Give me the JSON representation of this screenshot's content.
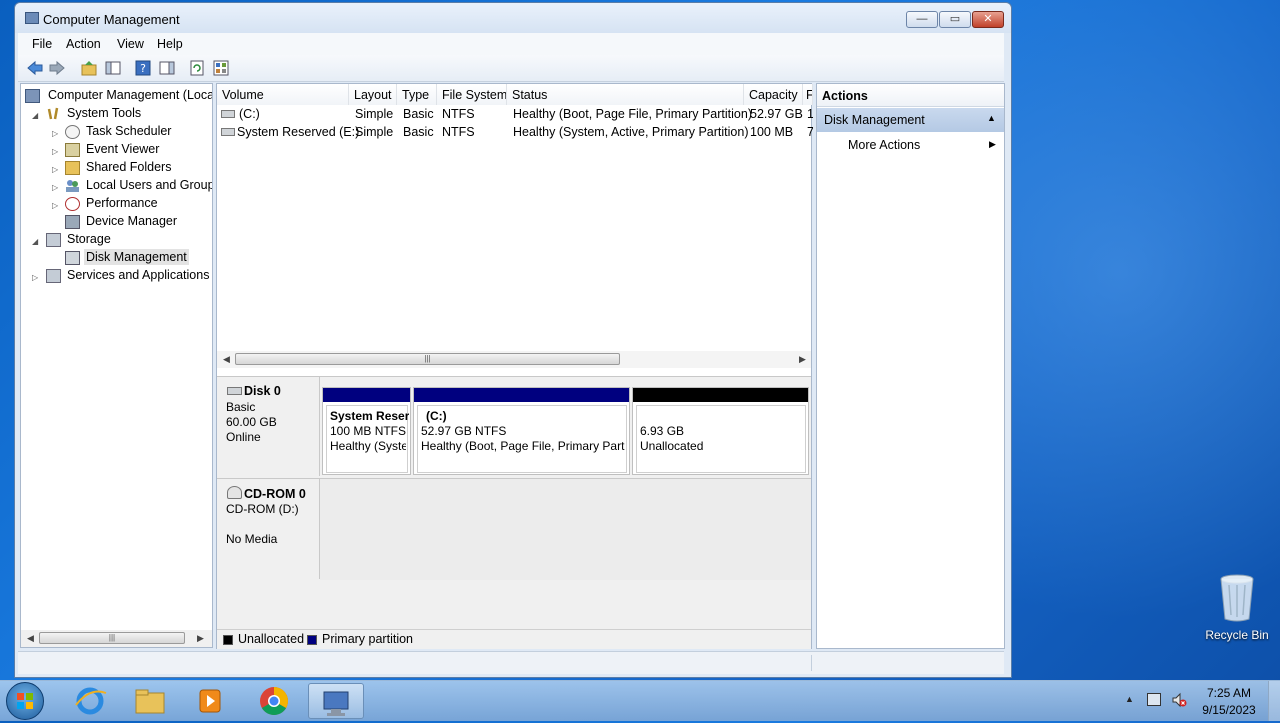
{
  "window": {
    "title": "Computer Management",
    "min_glyph": "—",
    "max_glyph": "▭",
    "close_glyph": "✕"
  },
  "menu": [
    "File",
    "Action",
    "View",
    "Help"
  ],
  "tree": {
    "root": "Computer Management (Local",
    "system_tools": "System Tools",
    "task_scheduler": "Task Scheduler",
    "event_viewer": "Event Viewer",
    "shared_folders": "Shared Folders",
    "local_users": "Local Users and Groups",
    "performance": "Performance",
    "device_manager": "Device Manager",
    "storage": "Storage",
    "disk_management": "Disk Management",
    "services": "Services and Applications"
  },
  "volume_list": {
    "headers": [
      "Volume",
      "Layout",
      "Type",
      "File System",
      "Status",
      "Capacity",
      "F"
    ],
    "rows": [
      {
        "volume": "(C:)",
        "layout": "Simple",
        "type": "Basic",
        "fs": "NTFS",
        "status": "Healthy (Boot, Page File, Primary Partition)",
        "capacity": "52.97 GB",
        "free": "1"
      },
      {
        "volume": "System Reserved (E:)",
        "layout": "Simple",
        "type": "Basic",
        "fs": "NTFS",
        "status": "Healthy (System, Active, Primary Partition)",
        "capacity": "100 MB",
        "free": "7"
      }
    ]
  },
  "disk0": {
    "name": "Disk 0",
    "kind": "Basic",
    "size": "60.00 GB",
    "state": "Online",
    "partitions": [
      {
        "title": "System Reser",
        "size": "100 MB NTFS",
        "status": "Healthy (Syste",
        "bar_color": "#00007f"
      },
      {
        "title": "(C:)",
        "size": "52.97 GB NTFS",
        "status": "Healthy (Boot, Page File, Primary Partit",
        "bar_color": "#00007f"
      },
      {
        "title": "",
        "size": "6.93 GB",
        "status": "Unallocated",
        "bar_color": "#000000"
      }
    ]
  },
  "cdrom0": {
    "name": "CD-ROM 0",
    "drive": "CD-ROM (D:)",
    "media": "No Media"
  },
  "legend": {
    "unallocated": "Unallocated",
    "primary": "Primary partition",
    "unallocated_color": "#000000",
    "primary_color": "#00007f"
  },
  "actions": {
    "header": "Actions",
    "section": "Disk Management",
    "more": "More Actions"
  },
  "desktop": {
    "recycle_bin": "Recycle Bin"
  },
  "taskbar": {
    "apps": [
      "start-orb",
      "internet-explorer",
      "windows-explorer",
      "media-player",
      "chrome",
      "computer-management"
    ],
    "time": "7:25 AM",
    "date": "9/15/2023"
  }
}
